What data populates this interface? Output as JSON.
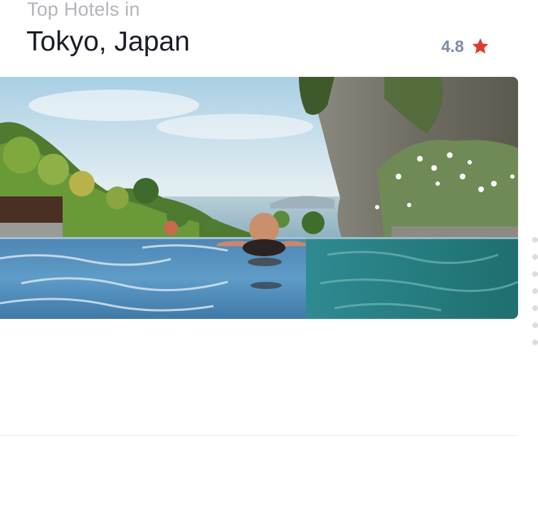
{
  "header": {
    "subtitle": "Top Hotels in",
    "title": "Tokyo, Japan"
  },
  "rating": {
    "value": "4.8",
    "icon": "star-icon",
    "color": "#e03b2f"
  },
  "hero_image": {
    "subject": "infinity pool overlooking the sea with limestone cliff"
  },
  "pager": {
    "dot_count": 7
  }
}
